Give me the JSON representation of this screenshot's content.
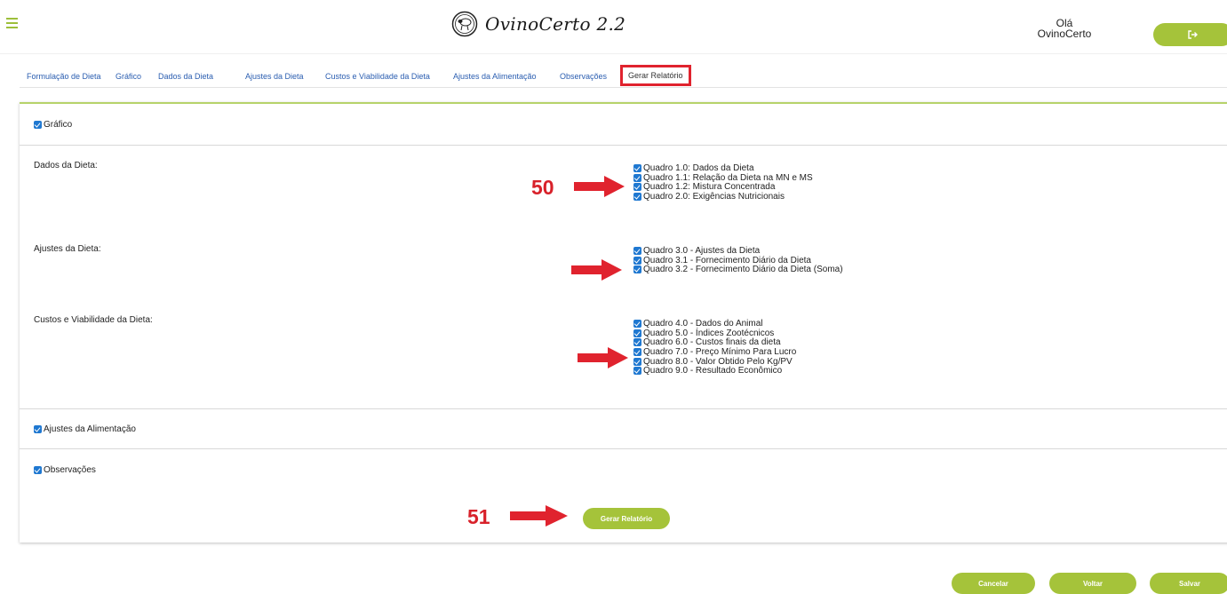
{
  "header": {
    "app_title": "OvinoCerto 2.2",
    "greeting_line1": "Olá",
    "greeting_line2": "OvinoCerto"
  },
  "tabs": [
    {
      "label": "Formulação de Dieta"
    },
    {
      "label": "Gráfico"
    },
    {
      "label": "Dados da Dieta"
    },
    {
      "label": "Ajustes da Dieta"
    },
    {
      "label": "Custos e Viabilidade da Dieta"
    },
    {
      "label": "Ajustes da Alimentação"
    },
    {
      "label": "Observações"
    },
    {
      "label": "Gerar Relatório",
      "active": true
    }
  ],
  "report": {
    "grafico_label": "Gráfico",
    "dados_label": "Dados da Dieta:",
    "dados_items": [
      "Quadro 1.0: Dados da Dieta",
      "Quadro 1.1: Relação da Dieta na MN e MS",
      "Quadro 1.2: Mistura Concentrada",
      "Quadro 2.0: Exigências Nutricionais"
    ],
    "ajustes_label": "Ajustes da Dieta:",
    "ajustes_items": [
      "Quadro 3.0 - Ajustes da Dieta",
      "Quadro 3.1 - Fornecimento Diário da Dieta",
      "Quadro 3.2 - Fornecimento Diário da Dieta (Soma)"
    ],
    "custos_label": "Custos e Viabilidade da Dieta:",
    "custos_items": [
      "Quadro 4.0 - Dados do Animal",
      "Quadro 5.0 - Índices Zootécnicos",
      "Quadro 6.0 - Custos finais da dieta",
      "Quadro 7.0 - Preço Mínimo Para Lucro",
      "Quadro 8.0 - Valor Obtido Pelo Kg/PV",
      "Quadro 9.0 - Resultado Econômico"
    ],
    "alimentacao_label": "Ajustes da Alimentação",
    "observacoes_label": "Observações",
    "generate_button": "Gerar Relatório"
  },
  "annotations": {
    "step_50": "50",
    "step_51": "51"
  },
  "footer": {
    "cancel": "Cancelar",
    "back": "Voltar",
    "save": "Salvar"
  },
  "colors": {
    "accent_green": "#a5c33a",
    "checkbox_blue": "#1f78d1",
    "annotation_red": "#d8212a",
    "tab_link_blue": "#2a5db0"
  }
}
